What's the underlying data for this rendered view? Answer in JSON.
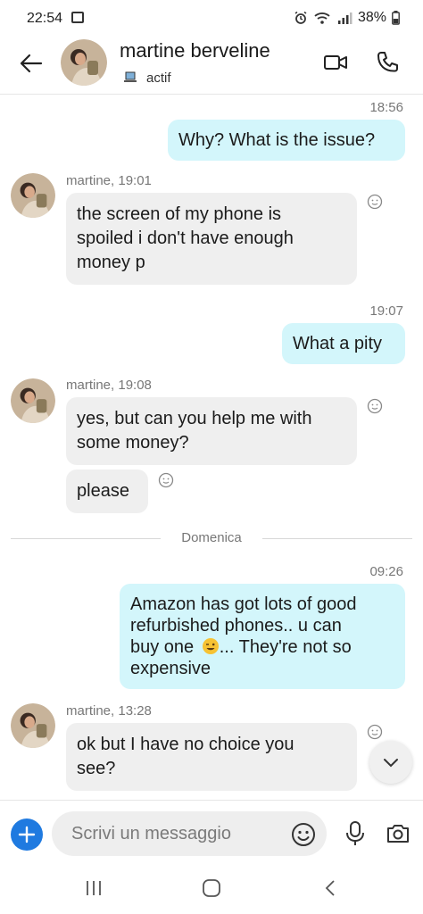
{
  "status_bar": {
    "time": "22:54",
    "battery": "38%"
  },
  "header": {
    "contact_name": "martine berveline",
    "status": "actif"
  },
  "messages": [
    {
      "type": "outgoing",
      "time": "18:56",
      "text": "Why? What is the issue?"
    },
    {
      "type": "incoming",
      "sender": "martine, 19:01",
      "lines": [
        "the screen of my phone is",
        "spoiled i don't have enough",
        "money p"
      ]
    },
    {
      "type": "outgoing",
      "time": "19:07",
      "text": "What a pity"
    },
    {
      "type": "incoming",
      "sender": "martine, 19:08",
      "lines": [
        "yes, but can you help me with",
        "some money?"
      ],
      "extra": "please"
    },
    {
      "type": "outgoing",
      "time": "09:26",
      "lines": [
        "Amazon has got lots of good",
        "refurbished phones.. u can",
        "buy one",
        "... They're not so",
        "expensive"
      ]
    },
    {
      "type": "incoming",
      "sender": "martine, 13:28",
      "lines": [
        "ok but I have no choice you",
        "see?"
      ]
    }
  ],
  "day_divider": "Domenica",
  "composer": {
    "placeholder": "Scrivi un messaggio"
  },
  "colors": {
    "outgoing_bubble": "#d3f6fb",
    "incoming_bubble": "#efefef",
    "accent": "#1f7ae0"
  }
}
